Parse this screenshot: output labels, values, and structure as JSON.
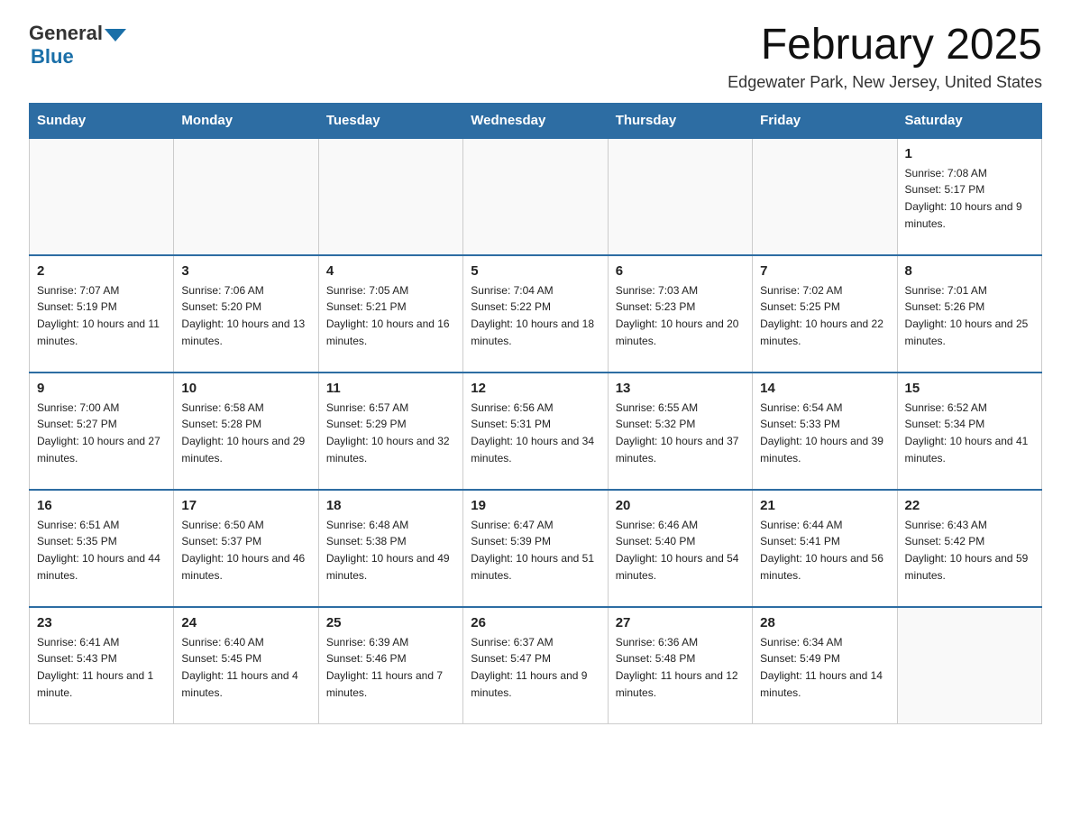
{
  "logo": {
    "text_general": "General",
    "text_blue": "Blue"
  },
  "title": "February 2025",
  "subtitle": "Edgewater Park, New Jersey, United States",
  "days_of_week": [
    "Sunday",
    "Monday",
    "Tuesday",
    "Wednesday",
    "Thursday",
    "Friday",
    "Saturday"
  ],
  "weeks": [
    [
      {
        "day": "",
        "info": ""
      },
      {
        "day": "",
        "info": ""
      },
      {
        "day": "",
        "info": ""
      },
      {
        "day": "",
        "info": ""
      },
      {
        "day": "",
        "info": ""
      },
      {
        "day": "",
        "info": ""
      },
      {
        "day": "1",
        "info": "Sunrise: 7:08 AM\nSunset: 5:17 PM\nDaylight: 10 hours and 9 minutes."
      }
    ],
    [
      {
        "day": "2",
        "info": "Sunrise: 7:07 AM\nSunset: 5:19 PM\nDaylight: 10 hours and 11 minutes."
      },
      {
        "day": "3",
        "info": "Sunrise: 7:06 AM\nSunset: 5:20 PM\nDaylight: 10 hours and 13 minutes."
      },
      {
        "day": "4",
        "info": "Sunrise: 7:05 AM\nSunset: 5:21 PM\nDaylight: 10 hours and 16 minutes."
      },
      {
        "day": "5",
        "info": "Sunrise: 7:04 AM\nSunset: 5:22 PM\nDaylight: 10 hours and 18 minutes."
      },
      {
        "day": "6",
        "info": "Sunrise: 7:03 AM\nSunset: 5:23 PM\nDaylight: 10 hours and 20 minutes."
      },
      {
        "day": "7",
        "info": "Sunrise: 7:02 AM\nSunset: 5:25 PM\nDaylight: 10 hours and 22 minutes."
      },
      {
        "day": "8",
        "info": "Sunrise: 7:01 AM\nSunset: 5:26 PM\nDaylight: 10 hours and 25 minutes."
      }
    ],
    [
      {
        "day": "9",
        "info": "Sunrise: 7:00 AM\nSunset: 5:27 PM\nDaylight: 10 hours and 27 minutes."
      },
      {
        "day": "10",
        "info": "Sunrise: 6:58 AM\nSunset: 5:28 PM\nDaylight: 10 hours and 29 minutes."
      },
      {
        "day": "11",
        "info": "Sunrise: 6:57 AM\nSunset: 5:29 PM\nDaylight: 10 hours and 32 minutes."
      },
      {
        "day": "12",
        "info": "Sunrise: 6:56 AM\nSunset: 5:31 PM\nDaylight: 10 hours and 34 minutes."
      },
      {
        "day": "13",
        "info": "Sunrise: 6:55 AM\nSunset: 5:32 PM\nDaylight: 10 hours and 37 minutes."
      },
      {
        "day": "14",
        "info": "Sunrise: 6:54 AM\nSunset: 5:33 PM\nDaylight: 10 hours and 39 minutes."
      },
      {
        "day": "15",
        "info": "Sunrise: 6:52 AM\nSunset: 5:34 PM\nDaylight: 10 hours and 41 minutes."
      }
    ],
    [
      {
        "day": "16",
        "info": "Sunrise: 6:51 AM\nSunset: 5:35 PM\nDaylight: 10 hours and 44 minutes."
      },
      {
        "day": "17",
        "info": "Sunrise: 6:50 AM\nSunset: 5:37 PM\nDaylight: 10 hours and 46 minutes."
      },
      {
        "day": "18",
        "info": "Sunrise: 6:48 AM\nSunset: 5:38 PM\nDaylight: 10 hours and 49 minutes."
      },
      {
        "day": "19",
        "info": "Sunrise: 6:47 AM\nSunset: 5:39 PM\nDaylight: 10 hours and 51 minutes."
      },
      {
        "day": "20",
        "info": "Sunrise: 6:46 AM\nSunset: 5:40 PM\nDaylight: 10 hours and 54 minutes."
      },
      {
        "day": "21",
        "info": "Sunrise: 6:44 AM\nSunset: 5:41 PM\nDaylight: 10 hours and 56 minutes."
      },
      {
        "day": "22",
        "info": "Sunrise: 6:43 AM\nSunset: 5:42 PM\nDaylight: 10 hours and 59 minutes."
      }
    ],
    [
      {
        "day": "23",
        "info": "Sunrise: 6:41 AM\nSunset: 5:43 PM\nDaylight: 11 hours and 1 minute."
      },
      {
        "day": "24",
        "info": "Sunrise: 6:40 AM\nSunset: 5:45 PM\nDaylight: 11 hours and 4 minutes."
      },
      {
        "day": "25",
        "info": "Sunrise: 6:39 AM\nSunset: 5:46 PM\nDaylight: 11 hours and 7 minutes."
      },
      {
        "day": "26",
        "info": "Sunrise: 6:37 AM\nSunset: 5:47 PM\nDaylight: 11 hours and 9 minutes."
      },
      {
        "day": "27",
        "info": "Sunrise: 6:36 AM\nSunset: 5:48 PM\nDaylight: 11 hours and 12 minutes."
      },
      {
        "day": "28",
        "info": "Sunrise: 6:34 AM\nSunset: 5:49 PM\nDaylight: 11 hours and 14 minutes."
      },
      {
        "day": "",
        "info": ""
      }
    ]
  ]
}
